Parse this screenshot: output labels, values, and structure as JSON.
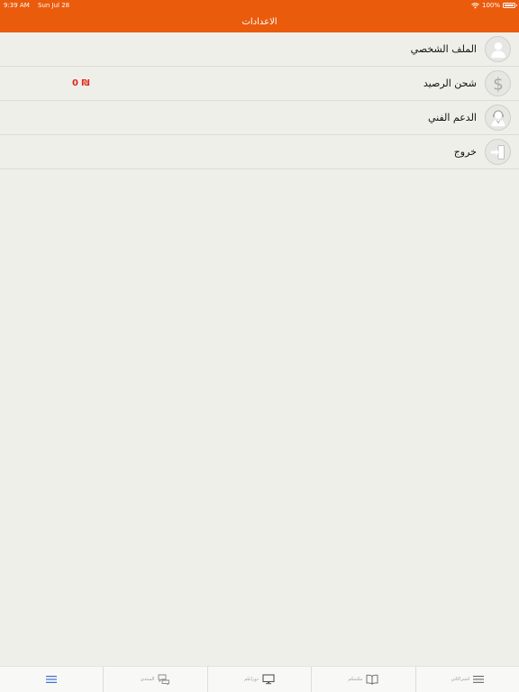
{
  "status_bar": {
    "time": "9:39 AM",
    "date": "Sun Jul 28",
    "battery": "100%"
  },
  "nav": {
    "title": "الاعدادات"
  },
  "menu": {
    "items": [
      {
        "label": "الملف الشخصي",
        "icon": "person-icon"
      },
      {
        "label": "شحن الرصيد",
        "icon": "dollar-icon",
        "balance": "0 ₪"
      },
      {
        "label": "الدعم الفني",
        "icon": "support-agent-icon"
      },
      {
        "label": "خروج",
        "icon": "logout-icon"
      }
    ]
  },
  "tabs": [
    {
      "label": "",
      "icon": "menu-icon",
      "active": true
    },
    {
      "label": "المنتدى",
      "icon": "chat-icon",
      "active": false
    },
    {
      "label": "دوراتكم",
      "icon": "monitor-icon",
      "active": false
    },
    {
      "label": "مكتبتكم",
      "icon": "book-icon",
      "active": false
    },
    {
      "label": "اشتراكاتي",
      "icon": "list-icon",
      "active": false
    }
  ],
  "colors": {
    "accent": "#ea5b0c",
    "active_tab": "#3b6fd1",
    "balance": "#e3261a",
    "background": "#efefea"
  }
}
